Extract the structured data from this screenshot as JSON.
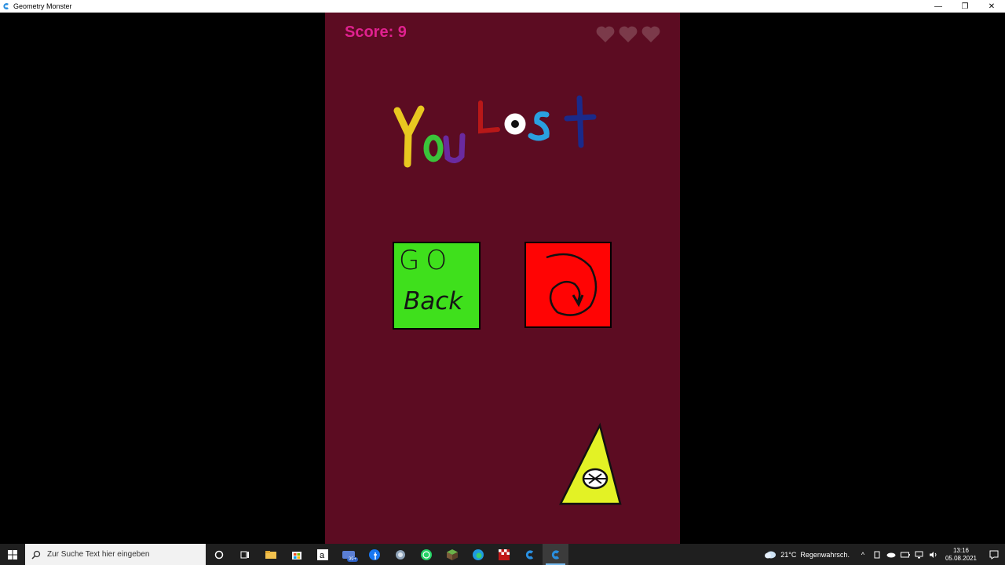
{
  "window": {
    "title": "Geometry Monster",
    "minimize_glyph": "—",
    "maximize_glyph": "❐",
    "close_glyph": "✕"
  },
  "game": {
    "score_text": "Score: 9",
    "lives": 3,
    "lives_max": 3,
    "title_text": "You Lost",
    "back_button": {
      "line1": "GO",
      "line2": "Back"
    },
    "retry_button": {
      "icon": "restart-spiral-icon"
    },
    "colors": {
      "background": "#5c0c22",
      "score": "#e0218f",
      "heart": "#7b3a4a",
      "back_button": "#3fe01c",
      "retry_button": "#ff0404",
      "monster": "#e3f225"
    }
  },
  "taskbar": {
    "search_placeholder": "Zur Suche Text hier eingeben",
    "apps": [
      {
        "name": "cortana-icon"
      },
      {
        "name": "task-view-icon"
      },
      {
        "name": "file-explorer-icon"
      },
      {
        "name": "store-icon"
      },
      {
        "name": "amazon-icon"
      },
      {
        "name": "mail-icon",
        "badge": "99+"
      },
      {
        "name": "facebook-icon"
      },
      {
        "name": "app-icon"
      },
      {
        "name": "whatsapp-icon"
      },
      {
        "name": "minecraft-icon"
      },
      {
        "name": "edge-icon"
      },
      {
        "name": "game-icon"
      },
      {
        "name": "geometry-monster-icon"
      },
      {
        "name": "geometry-monster-active-icon",
        "active": true
      }
    ],
    "weather": {
      "temp": "21°C",
      "desc": "Regenwahrsch."
    },
    "clock": {
      "time": "13:16",
      "date": "05.08.2021"
    }
  }
}
